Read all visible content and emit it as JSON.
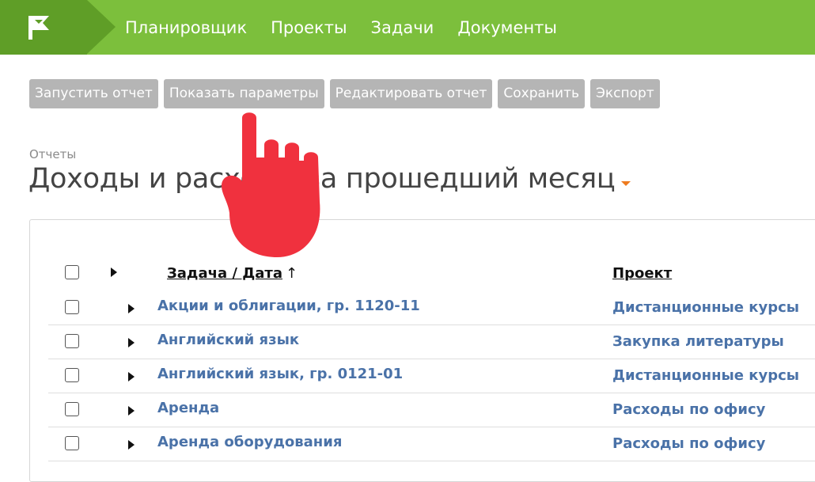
{
  "header": {
    "nav": [
      "Планировщик",
      "Проекты",
      "Задачи",
      "Документы"
    ],
    "logo_icon": "flag-logo-icon",
    "color": "#7cbf3c"
  },
  "toolbar": {
    "run": "Запустить отчет",
    "params": "Показать параметры",
    "edit": "Редактировать отчет",
    "save": "Сохранить",
    "export": "Экспорт"
  },
  "breadcrumb": "Отчеты",
  "title": "Доходы и расходы за прошедший месяц",
  "table": {
    "headers": {
      "task": "Задача / Дата",
      "sort_indicator": "↑",
      "project": "Проект"
    },
    "rows": [
      {
        "task": "Акции и облигации, гр. 1120-11",
        "project": "Дистанционные курсы"
      },
      {
        "task": "Английский язык",
        "project": "Закупка литературы"
      },
      {
        "task": "Английский язык, гр. 0121-01",
        "project": "Дистанционные курсы"
      },
      {
        "task": "Аренда",
        "project": "Расходы по офису"
      },
      {
        "task": "Аренда оборудования",
        "project": "Расходы по офису"
      }
    ]
  },
  "link_color": "#4a72a8",
  "overlay_icon": "pointing-hand-icon"
}
